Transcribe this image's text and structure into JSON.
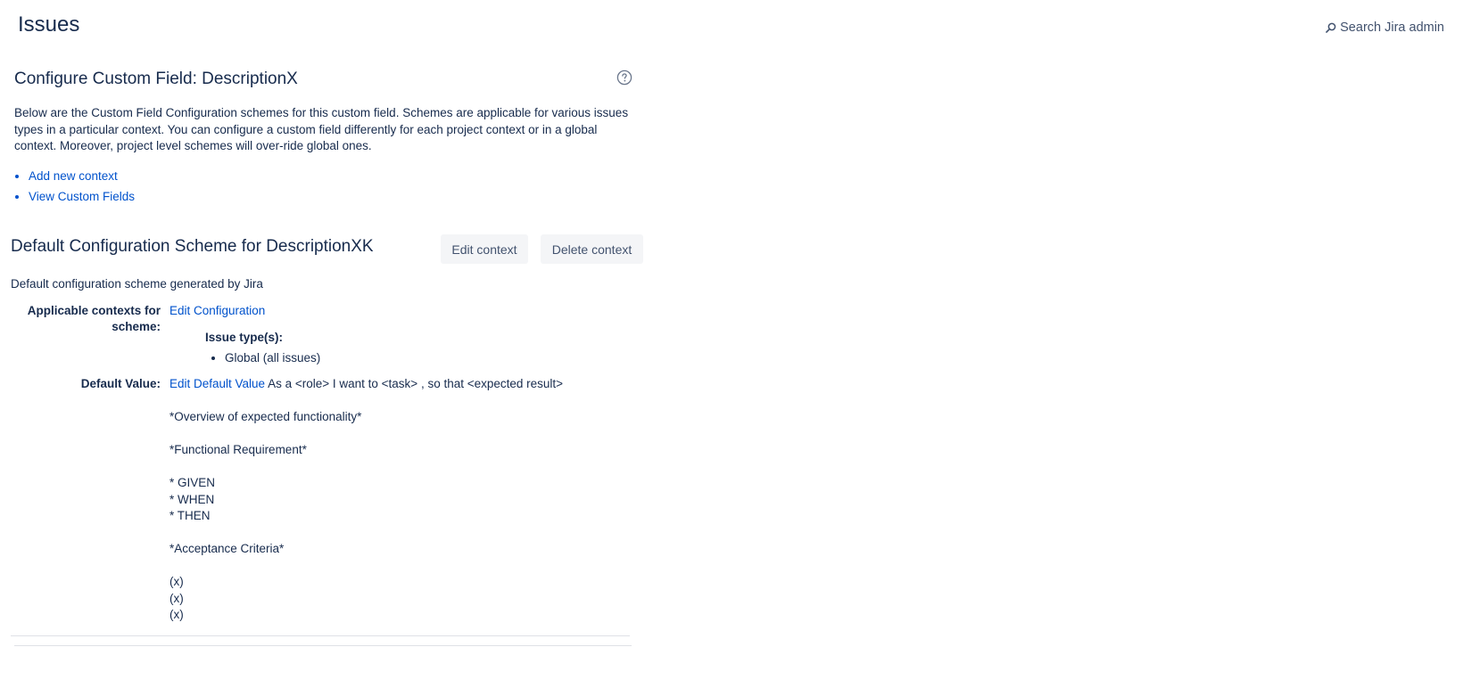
{
  "header": {
    "title": "Issues",
    "search_label": "Search Jira admin"
  },
  "configure": {
    "title": "Configure Custom Field: DescriptionX",
    "description": "Below are the Custom Field Configuration schemes for this custom field. Schemes are applicable for various issues types in a particular context. You can configure a custom field differently for each project context or in a global context. Moreover, project level schemes will over-ride global ones.",
    "links": [
      "Add new context",
      "View Custom Fields"
    ]
  },
  "scheme": {
    "title": "Default Configuration Scheme for DescriptionXK",
    "edit_context_label": "Edit context",
    "delete_context_label": "Delete context",
    "description": "Default configuration scheme generated by Jira",
    "applicable_contexts_label": "Applicable contexts for scheme:",
    "edit_configuration_label": "Edit Configuration",
    "issue_types_label": "Issue type(s):",
    "issue_types": [
      "Global (all issues)"
    ],
    "default_value_label": "Default Value:",
    "edit_default_value_label": "Edit Default Value",
    "default_value_text": "As a <role> I want to <task> , so that <expected result>\n\n*Overview of expected functionality*\n\n*Functional Requirement*\n\n* GIVEN\n* WHEN\n* THEN\n\n*Acceptance Criteria*\n\n(x)\n(x)\n(x)"
  },
  "colors": {
    "text": "#172b4d",
    "link": "#0052cc",
    "button_bg": "#f4f5f7",
    "button_text": "#42526e",
    "divider": "#dfe1e6"
  }
}
